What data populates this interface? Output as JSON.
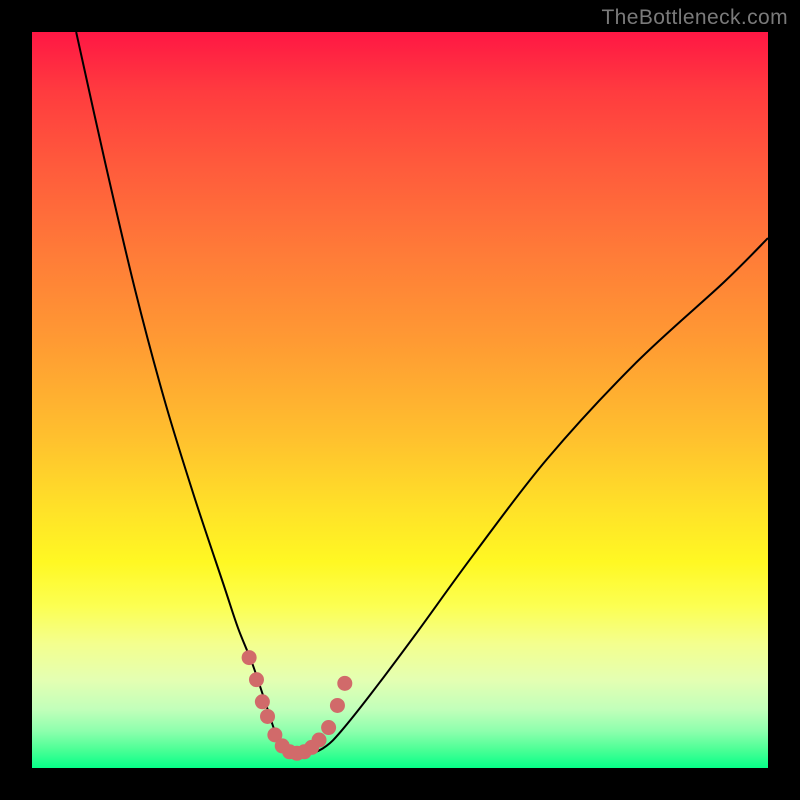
{
  "watermark": "TheBottleneck.com",
  "chart_data": {
    "type": "line",
    "title": "",
    "xlabel": "",
    "ylabel": "",
    "xlim": [
      0,
      100
    ],
    "ylim": [
      0,
      100
    ],
    "grid": false,
    "gradient": {
      "top": "#ff1744",
      "mid": "#ffe228",
      "bottom": "#06ff88"
    },
    "series": [
      {
        "name": "bottleneck-curve",
        "color": "#000000",
        "x": [
          6,
          10,
          14,
          18,
          22,
          26,
          28,
          30,
          32,
          33,
          34,
          35,
          36,
          38,
          40,
          42,
          46,
          52,
          60,
          70,
          82,
          94,
          100
        ],
        "values": [
          100,
          82,
          65,
          50,
          37,
          25,
          19,
          14,
          8,
          5,
          3,
          2,
          2,
          2,
          3,
          5,
          10,
          18,
          29,
          42,
          55,
          66,
          72
        ]
      },
      {
        "name": "highlighted-points",
        "color": "#d16a6a",
        "type": "scatter",
        "x": [
          29.5,
          30.5,
          31.3,
          32.0,
          33.0,
          34.0,
          35.0,
          36.0,
          37.0,
          38.0,
          39.0,
          40.3,
          41.5,
          42.5
        ],
        "values": [
          15,
          12,
          9,
          7,
          4.5,
          3,
          2.2,
          2.0,
          2.2,
          2.8,
          3.8,
          5.5,
          8.5,
          11.5
        ]
      }
    ]
  }
}
